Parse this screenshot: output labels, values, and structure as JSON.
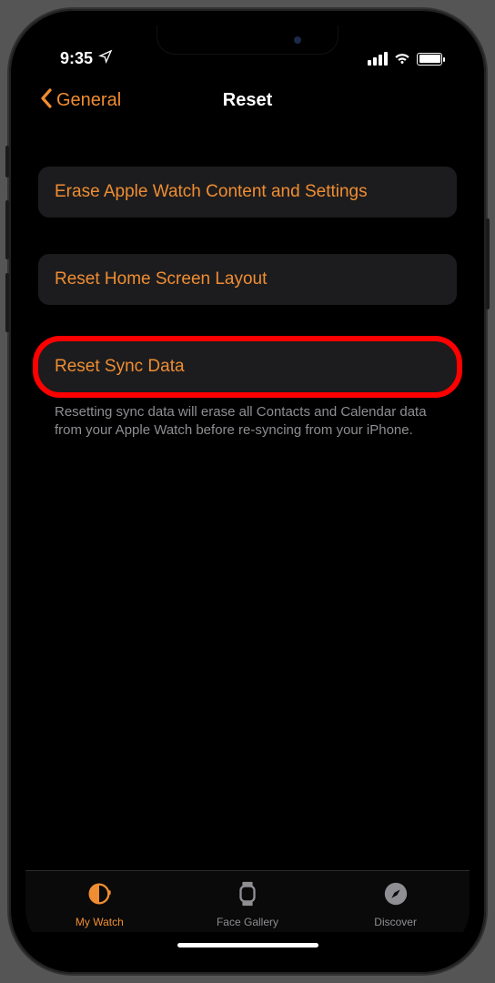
{
  "status": {
    "time": "9:35"
  },
  "nav": {
    "back_label": "General",
    "title": "Reset"
  },
  "options": {
    "erase": "Erase Apple Watch Content and Settings",
    "reset_home": "Reset Home Screen Layout",
    "reset_sync": "Reset Sync Data"
  },
  "footer": "Resetting sync data will erase all Contacts and Calendar data from your Apple Watch before re-syncing from your iPhone.",
  "tabs": {
    "my_watch": "My Watch",
    "face_gallery": "Face Gallery",
    "discover": "Discover"
  }
}
